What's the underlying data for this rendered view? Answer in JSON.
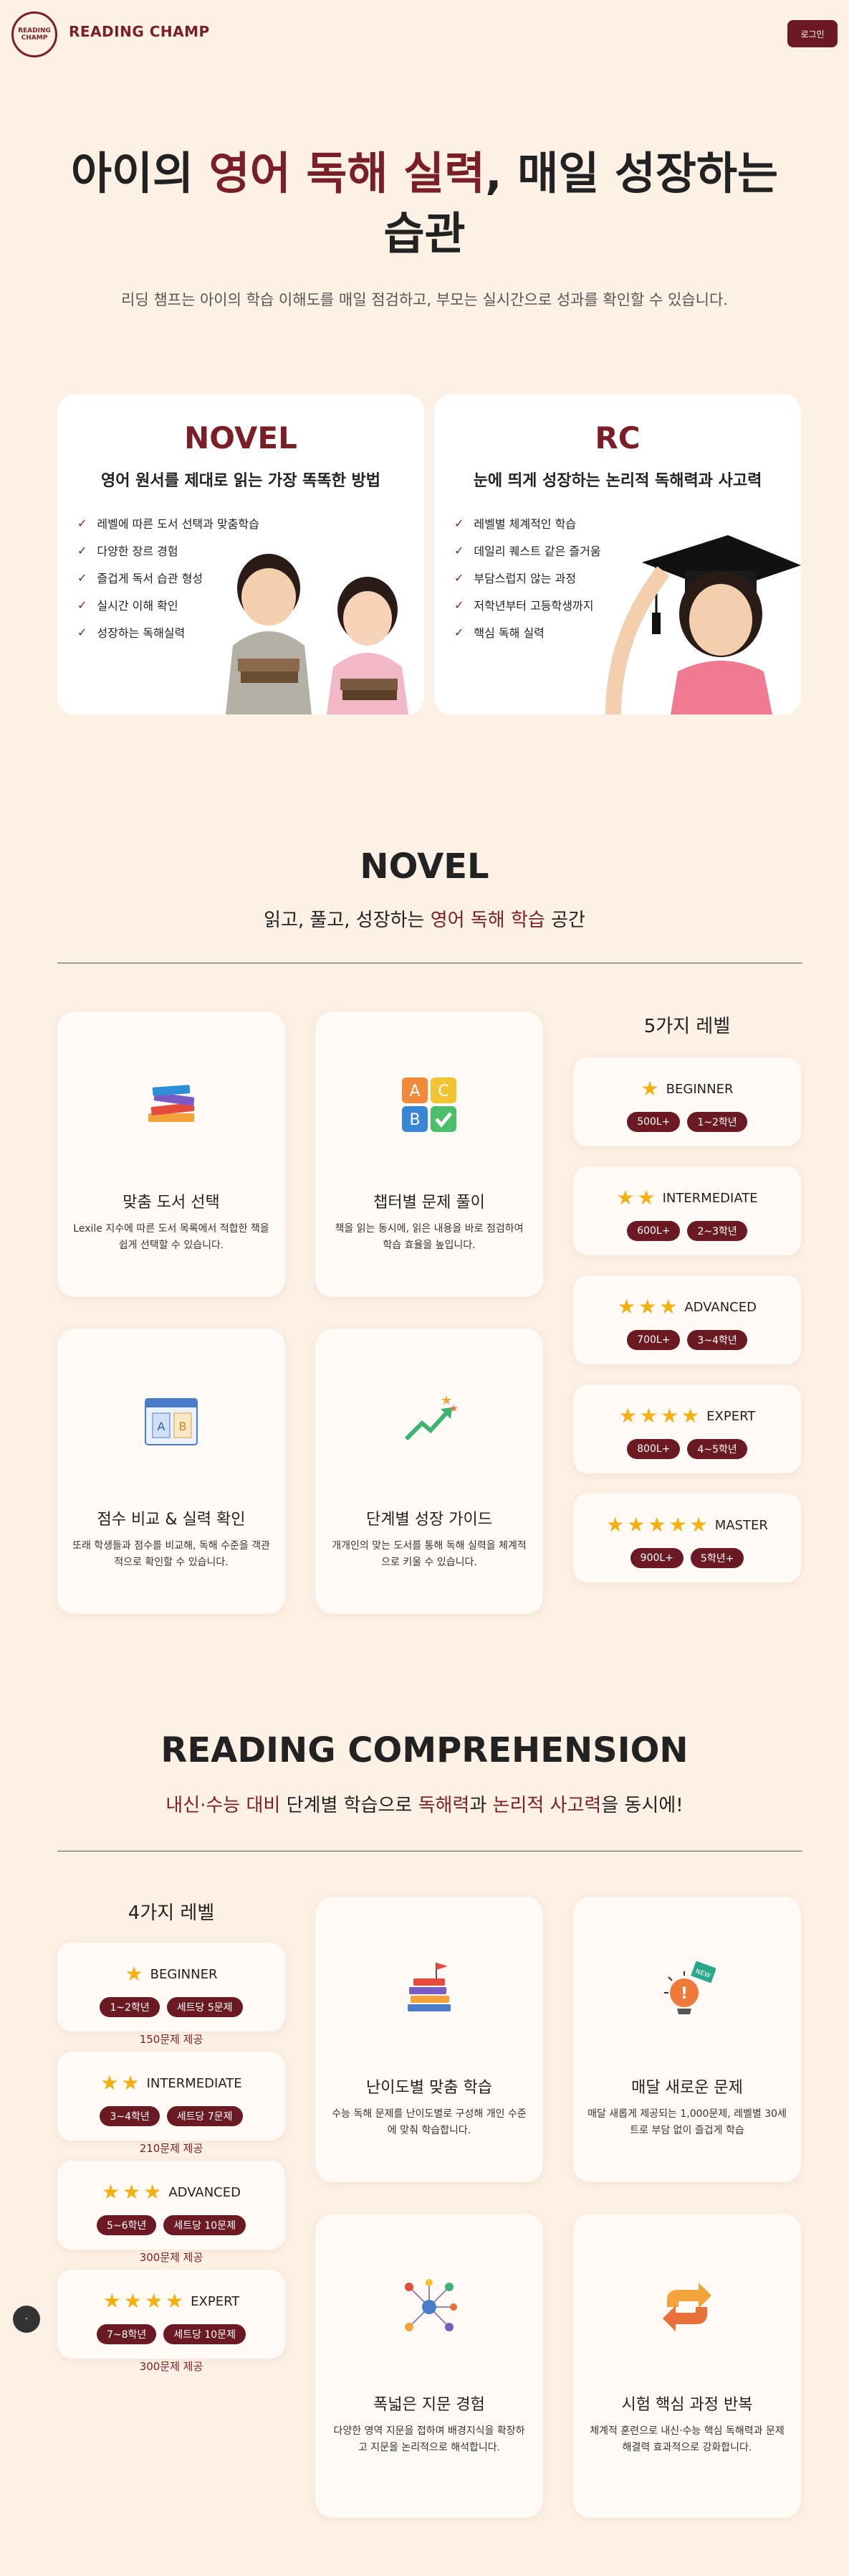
{
  "header": {
    "brand": "READING CHAMP",
    "logo_text": "READING CHAMP",
    "login_label": "로그인"
  },
  "hero": {
    "title_pre": "아이의 ",
    "title_highlight": "영어 독해 실력",
    "title_post": ", 매일 성장하는 습관",
    "subtitle": "리딩 챔프는 아이의 학습 이해도를 매일 점검하고, 부모는 실시간으로 성과를 확인할 수 있습니다."
  },
  "programs": {
    "novel": {
      "title": "NOVEL",
      "subtitle": "영어 원서를 제대로 읽는 가장 똑똑한 방법",
      "items": [
        "레벨에 따른 도서 선택과 맞춤학습",
        "다양한 장르 경험",
        "즐겁게 독서 습관 형성",
        "실시간 이해 확인",
        "성장하는 독해실력"
      ]
    },
    "rc": {
      "title": "RC",
      "subtitle": "눈에 띄게 성장하는 논리적 독해력과 사고력",
      "items": [
        "레벨별 체계적인 학습",
        "데일리 퀘스트 같은 즐거움",
        "부담스럽지 않는 과정",
        "저학년부터 고등학생까지",
        "핵심 독해 실력"
      ]
    }
  },
  "novel_section": {
    "title": "NOVEL",
    "sub_pre": "읽고, 풀고, 성장하는 ",
    "sub_highlight": "영어 독해 학습",
    "sub_post": " 공간",
    "features": [
      {
        "icon": "books-icon",
        "title": "맞춤 도서 선택",
        "desc": "Lexile 지수에 따른 도서 목록에서 적합한 책을 쉽게 선택할 수 있습니다."
      },
      {
        "icon": "abc-blocks-icon",
        "title": "챕터별 문제 풀이",
        "desc": "책을 읽는 동시에, 읽은 내용을 바로 점검하여 학습 효율을 높입니다."
      },
      {
        "icon": "score-compare-icon",
        "title": "점수 비교 & 실력 확인",
        "desc": "또래 학생들과 점수를 비교해, 독해 수준을 객관적으로 확인할 수 있습니다."
      },
      {
        "icon": "growth-arrow-icon",
        "title": "단계별 성장 가이드",
        "desc": "개개인의 맞는 도서를 통해 독해 실력을 체계적으로 키울 수 있습니다."
      }
    ],
    "levels_title": "5가지 레벨",
    "levels": [
      {
        "stars": 1,
        "name": "BEGINNER",
        "score": "500L+",
        "grade": "1~2학년"
      },
      {
        "stars": 2,
        "name": "INTERMEDIATE",
        "score": "600L+",
        "grade": "2~3학년"
      },
      {
        "stars": 3,
        "name": "ADVANCED",
        "score": "700L+",
        "grade": "3~4학년"
      },
      {
        "stars": 4,
        "name": "EXPERT",
        "score": "800L+",
        "grade": "4~5학년"
      },
      {
        "stars": 5,
        "name": "MASTER",
        "score": "900L+",
        "grade": "5학년+"
      }
    ]
  },
  "rc_section": {
    "title": "READING COMPREHENSION",
    "sub_h1": "내신·수능 대비",
    "sub_t1": " 단계별 학습으로 ",
    "sub_h2": "독해력",
    "sub_t2": "과 ",
    "sub_h3": "논리적 사고력",
    "sub_t3": "을 동시에!",
    "levels_title": "4가지 레벨",
    "levels": [
      {
        "stars": 1,
        "name": "BEGINNER",
        "grade": "1~2학년",
        "set": "세트당 5문제",
        "note": "150문제 제공"
      },
      {
        "stars": 2,
        "name": "INTERMEDIATE",
        "grade": "3~4학년",
        "set": "세트당 7문제",
        "note": "210문제 제공"
      },
      {
        "stars": 3,
        "name": "ADVANCED",
        "grade": "5~6학년",
        "set": "세트당 10문제",
        "note": "300문제 제공"
      },
      {
        "stars": 4,
        "name": "EXPERT",
        "grade": "7~8학년",
        "set": "세트당 10문제",
        "note": "300문제 제공"
      }
    ],
    "features": [
      {
        "icon": "stacked-books-flag-icon",
        "title": "난이도별 맞춤 학습",
        "desc": "수능 독해 문제를 난이도별로 구성해 개인 수준에 맞춰 학습합니다."
      },
      {
        "icon": "new-alert-icon",
        "title": "매달 새로운 문제",
        "desc": "매달 새롭게 제공되는 1,000문제, 레벨별 30세트로 부담 없이 즐겁게 학습"
      },
      {
        "icon": "network-icon",
        "title": "폭넓은 지문 경험",
        "desc": "다양한 영역 지문을 접하며 배경지식을 확장하고 지문을 논리적으로 해석합니다."
      },
      {
        "icon": "repeat-arrows-icon",
        "title": "시험 핵심 과정 반복",
        "desc": "체계적 훈련으로 내신·수능 핵심 독해력과 문제 해결력 효과적으로 강화합니다."
      }
    ],
    "new_badge": "NEW"
  },
  "float_button_label": "·"
}
